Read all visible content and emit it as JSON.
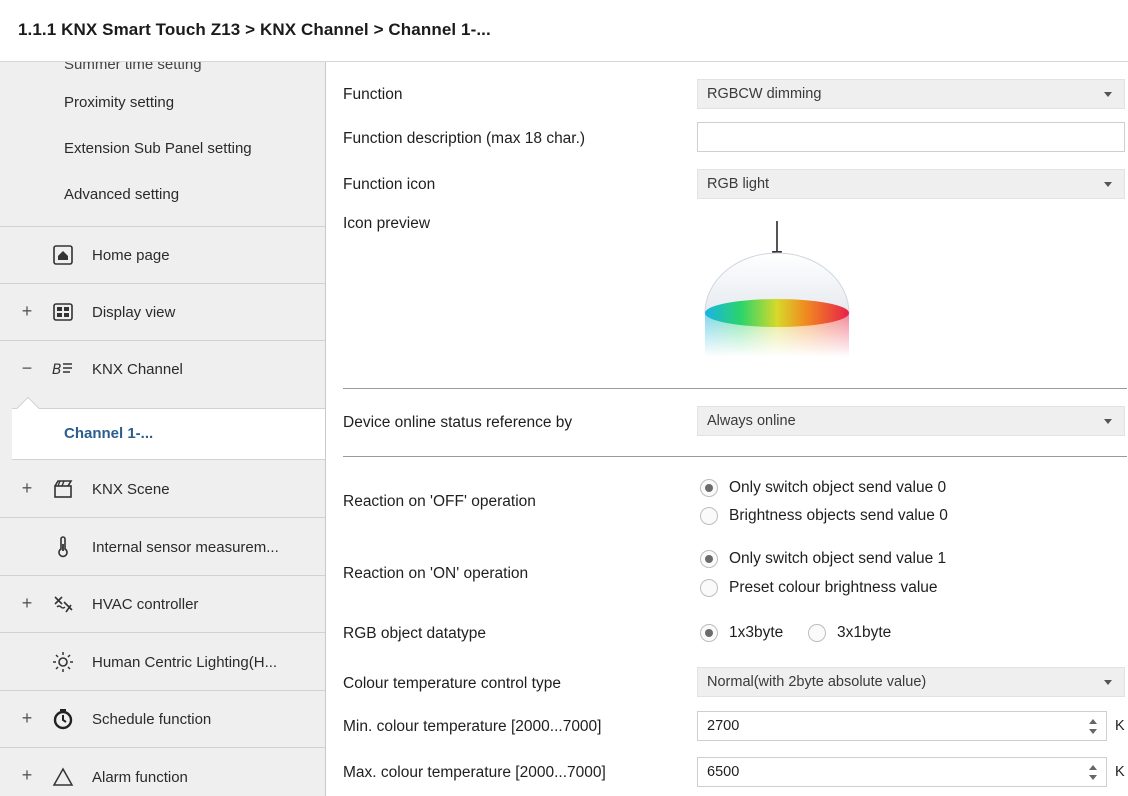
{
  "breadcrumb": "1.1.1 KNX Smart Touch Z13 > KNX Channel  > Channel 1-...",
  "sidebar": {
    "partial_item": "Summer time setting",
    "sub_items": [
      "Proximity setting",
      "Extension Sub Panel setting",
      "Advanced setting"
    ],
    "items": [
      {
        "label": "Home page",
        "expander": "",
        "icon": "home-icon"
      },
      {
        "label": "Display view",
        "expander": "+",
        "icon": "display-view-icon"
      },
      {
        "label": "KNX Channel",
        "expander": "−",
        "icon": "knx-channel-icon"
      },
      {
        "label": "KNX Scene",
        "expander": "+",
        "icon": "scene-icon"
      },
      {
        "label": "Internal sensor measurem...",
        "expander": "",
        "icon": "thermometer-icon"
      },
      {
        "label": "HVAC controller",
        "expander": "+",
        "icon": "hvac-icon"
      },
      {
        "label": "Human Centric Lighting(H...",
        "expander": "",
        "icon": "sun-icon"
      },
      {
        "label": "Schedule function",
        "expander": "+",
        "icon": "clock-icon"
      },
      {
        "label": "Alarm function",
        "expander": "+",
        "icon": "alarm-triangle-icon"
      }
    ],
    "active_child": "Channel 1-..."
  },
  "form": {
    "function": {
      "label": "Function",
      "value": "RGBCW dimming"
    },
    "description": {
      "label": "Function description (max 18 char.)",
      "value": ""
    },
    "icon": {
      "label": "Function icon",
      "value": "RGB light"
    },
    "icon_preview_label": "Icon preview",
    "online_status": {
      "label": "Device online status reference by",
      "value": "Always online"
    },
    "reaction_off": {
      "label": "Reaction on 'OFF' operation",
      "options": [
        "Only switch object send value 0",
        "Brightness objects send value 0"
      ],
      "selected": 0
    },
    "reaction_on": {
      "label": "Reaction on 'ON' operation",
      "options": [
        "Only switch object send value 1",
        "Preset colour brightness value"
      ],
      "selected": 0
    },
    "rgb_datatype": {
      "label": "RGB object datatype",
      "options": [
        "1x3byte",
        "3x1byte"
      ],
      "selected": 0
    },
    "ct_control": {
      "label": "Colour temperature control type",
      "value": "Normal(with 2byte absolute value)"
    },
    "min_ct": {
      "label": "Min. colour temperature [2000...7000]",
      "value": "2700",
      "unit": "K"
    },
    "max_ct": {
      "label": "Max. colour temperature [2000...7000]",
      "value": "6500",
      "unit": "K"
    }
  }
}
